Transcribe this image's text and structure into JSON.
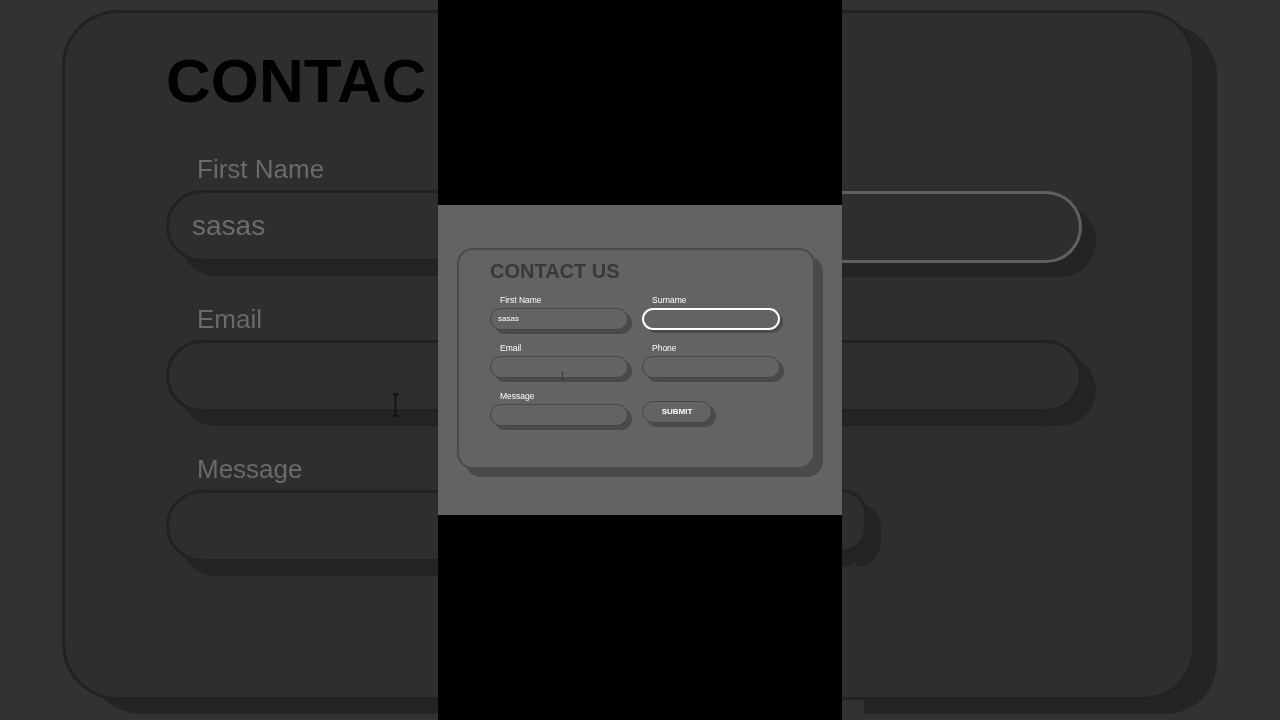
{
  "backdrop": {
    "title": "CONTAC",
    "left_fields": [
      {
        "label": "First Name",
        "value": "sasas",
        "cursor": false
      },
      {
        "label": "Email",
        "cursor": true
      },
      {
        "label": "Message",
        "cursor": false
      }
    ],
    "right_pieces": [
      {
        "kind": "field",
        "focused": true
      },
      {
        "kind": "field",
        "focused": false
      },
      {
        "kind": "button"
      }
    ]
  },
  "form": {
    "title": "CONTACT US",
    "fields": [
      {
        "label": "First Name",
        "kind": "text",
        "value": "sasas",
        "focused": false,
        "cursor": false
      },
      {
        "label": "Surname",
        "kind": "text",
        "focused": true,
        "cursor": false
      },
      {
        "label": "Email",
        "kind": "text",
        "focused": false,
        "cursor": true
      },
      {
        "label": "Phone",
        "kind": "text",
        "focused": false,
        "cursor": false
      },
      {
        "label": "Message",
        "kind": "textarea",
        "focused": false,
        "cursor": false
      }
    ],
    "submit": {
      "label": "SUBMIT"
    }
  }
}
